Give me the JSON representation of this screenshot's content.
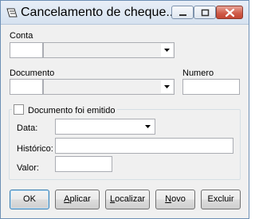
{
  "window": {
    "title": "Cancelamento de cheque..."
  },
  "form": {
    "conta_label": "Conta",
    "conta_value": "",
    "conta_combo_value": "",
    "documento_label": "Documento",
    "documento_value": "",
    "documento_combo_value": "",
    "numero_label": "Numero",
    "numero_value": ""
  },
  "group": {
    "checkbox_label": "Documento foi emitido",
    "checked": false,
    "data_label": "Data:",
    "data_value": "",
    "historico_label": "Histórico:",
    "historico_value": "",
    "valor_label": "Valor:",
    "valor_value": ""
  },
  "buttons": {
    "ok": {
      "label": "OK"
    },
    "aplicar": {
      "label": "plicar",
      "mnemonic": "A"
    },
    "localizar": {
      "label": "ocalizar",
      "mnemonic": "L"
    },
    "novo": {
      "label": "ovo",
      "mnemonic": "N"
    },
    "excluir": {
      "label": "Excluir"
    }
  },
  "colors": {
    "window_bg": "#f0f0f0",
    "title_bar": "#d6e2f0",
    "close_button": "#c34633",
    "field_border": "#abadb3"
  }
}
